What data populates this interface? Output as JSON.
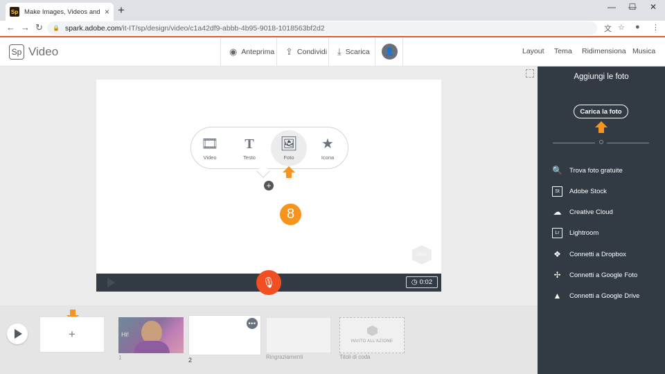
{
  "browser": {
    "tab_favicon": "Sp",
    "tab_title": "Make Images, Videos and Web S",
    "tab_close": "×",
    "new_tab": "+",
    "url_domain": "spark.adobe.com",
    "url_path": "/it-IT/sp/design/video/c1a42df9-abbb-4b95-9018-1018563bf2d2",
    "back": "←",
    "forward": "→",
    "reload": "↻",
    "minimize": "—",
    "maximize": "☐",
    "close": "✕"
  },
  "header": {
    "logo": "Sp",
    "app_name": "Video",
    "preview": "Anteprima",
    "share": "Condividi",
    "download": "Scarica",
    "menu": [
      "Layout",
      "Tema",
      "Ridimensiona",
      "Musica"
    ]
  },
  "canvas": {
    "options": [
      {
        "label": "Video",
        "icon": "film-icon"
      },
      {
        "label": "Testo",
        "icon": "text-icon"
      },
      {
        "label": "Foto",
        "icon": "photo-icon",
        "selected": true
      },
      {
        "label": "Icona",
        "icon": "star-icon"
      }
    ],
    "step_number": "8",
    "logo_placeholder": "LOGO",
    "duration": "0:02"
  },
  "timeline": {
    "thumb1_text": "Hi!",
    "labels": [
      "1",
      "2",
      "Ringraziamenti",
      "Titoli di coda"
    ],
    "cta_card": "INVITO ALL'AZIONE"
  },
  "panel": {
    "title": "Aggiungi le foto",
    "upload": "Carica la foto",
    "sources": [
      {
        "label": "Trova foto gratuite",
        "icon": "search-icon"
      },
      {
        "label": "Adobe Stock",
        "icon": "adobe-stock-icon",
        "badge": "St"
      },
      {
        "label": "Creative Cloud",
        "icon": "creative-cloud-icon"
      },
      {
        "label": "Lightroom",
        "icon": "lightroom-icon",
        "badge": "Lr"
      },
      {
        "label": "Connetti a Dropbox",
        "icon": "dropbox-icon"
      },
      {
        "label": "Connetti a Google Foto",
        "icon": "google-photos-icon"
      },
      {
        "label": "Connetti a Google Drive",
        "icon": "google-drive-icon"
      }
    ]
  },
  "colors": {
    "accent": "#f04e23",
    "highlight": "#f7941d",
    "panel": "#323a44"
  }
}
